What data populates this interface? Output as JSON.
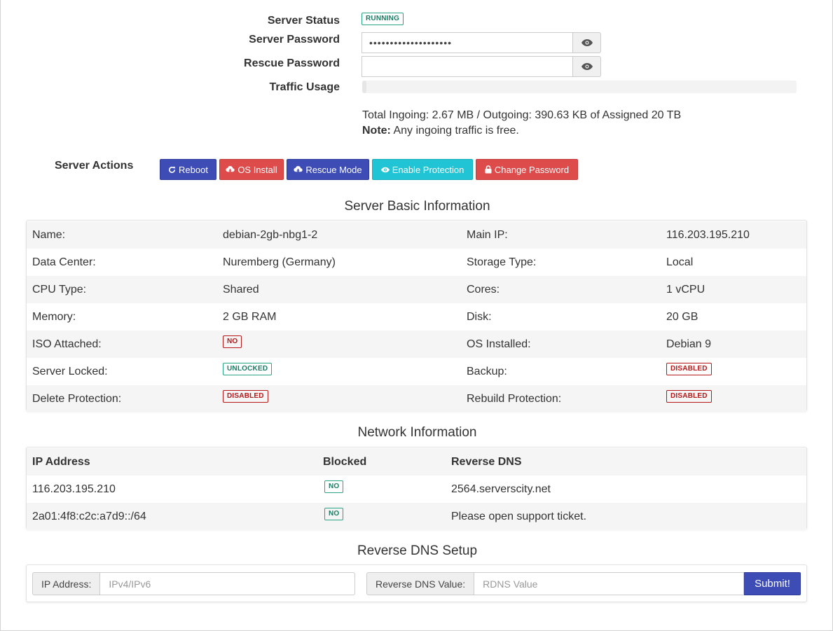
{
  "status": {
    "server_status_label": "Server Status",
    "server_status_badge": "RUNNING",
    "server_password_label": "Server Password",
    "server_password_value": "••••••••••••••••••••",
    "rescue_password_label": "Rescue Password",
    "rescue_password_value": "",
    "traffic_usage_label": "Traffic Usage",
    "traffic_progress_percent": 1,
    "traffic_text": "Total Ingoing: 2.67 MB / Outgoing: 390.63 KB of Assigned 20 TB",
    "note_bold": "Note:",
    "note_text": " Any ingoing traffic is free."
  },
  "actions": {
    "label": "Server Actions",
    "reboot": "Reboot",
    "os_install": "OS Install",
    "rescue_mode": "Rescue Mode",
    "enable_protection": "Enable Protection",
    "change_password": "Change Password"
  },
  "basic_info": {
    "title": "Server Basic Information",
    "rows": [
      {
        "l1": "Name:",
        "v1": "debian-2gb-nbg1-2",
        "l2": "Main IP:",
        "v2": "116.203.195.210"
      },
      {
        "l1": "Data Center:",
        "v1": "Nuremberg (Germany)",
        "l2": "Storage Type:",
        "v2": "Local"
      },
      {
        "l1": "CPU Type:",
        "v1": "Shared",
        "l2": "Cores:",
        "v2": "1 vCPU"
      },
      {
        "l1": "Memory:",
        "v1": "2 GB RAM",
        "l2": "Disk:",
        "v2": "20 GB"
      },
      {
        "l1": "ISO Attached:",
        "v1": "NO",
        "l2": "OS Installed:",
        "v2": "Debian 9"
      },
      {
        "l1": "Server Locked:",
        "v1": "UNLOCKED",
        "l2": "Backup:",
        "v2": "DISABLED"
      },
      {
        "l1": "Delete Protection:",
        "v1": "DISABLED",
        "l2": "Rebuild Protection:",
        "v2": "DISABLED"
      }
    ]
  },
  "network": {
    "title": "Network Information",
    "headers": {
      "ip": "IP Address",
      "blocked": "Blocked",
      "rdns": "Reverse DNS"
    },
    "rows": [
      {
        "ip": "116.203.195.210",
        "blocked": "NO",
        "rdns": "2564.serverscity.net"
      },
      {
        "ip": "2a01:4f8:c2c:a7d9::/64",
        "blocked": "NO",
        "rdns": "Please open support ticket."
      }
    ]
  },
  "rdns_setup": {
    "title": "Reverse DNS Setup",
    "ip_label": "IP Address:",
    "ip_placeholder": "IPv4/IPv6",
    "value_label": "Reverse DNS Value:",
    "value_placeholder": "RDNS Value",
    "submit": "Submit!"
  },
  "icons": {
    "eye": "eye-icon",
    "reboot": "refresh-icon",
    "os_install": "cloud-download-icon",
    "rescue_mode": "cloud-download-icon",
    "enable_protection": "eye-icon",
    "change_password": "lock-icon"
  },
  "colors": {
    "primary": "#3d4db5",
    "danger": "#dd4b4b",
    "info": "#21c4d4",
    "badge_green": "#2aa384",
    "badge_red": "#b41818"
  }
}
